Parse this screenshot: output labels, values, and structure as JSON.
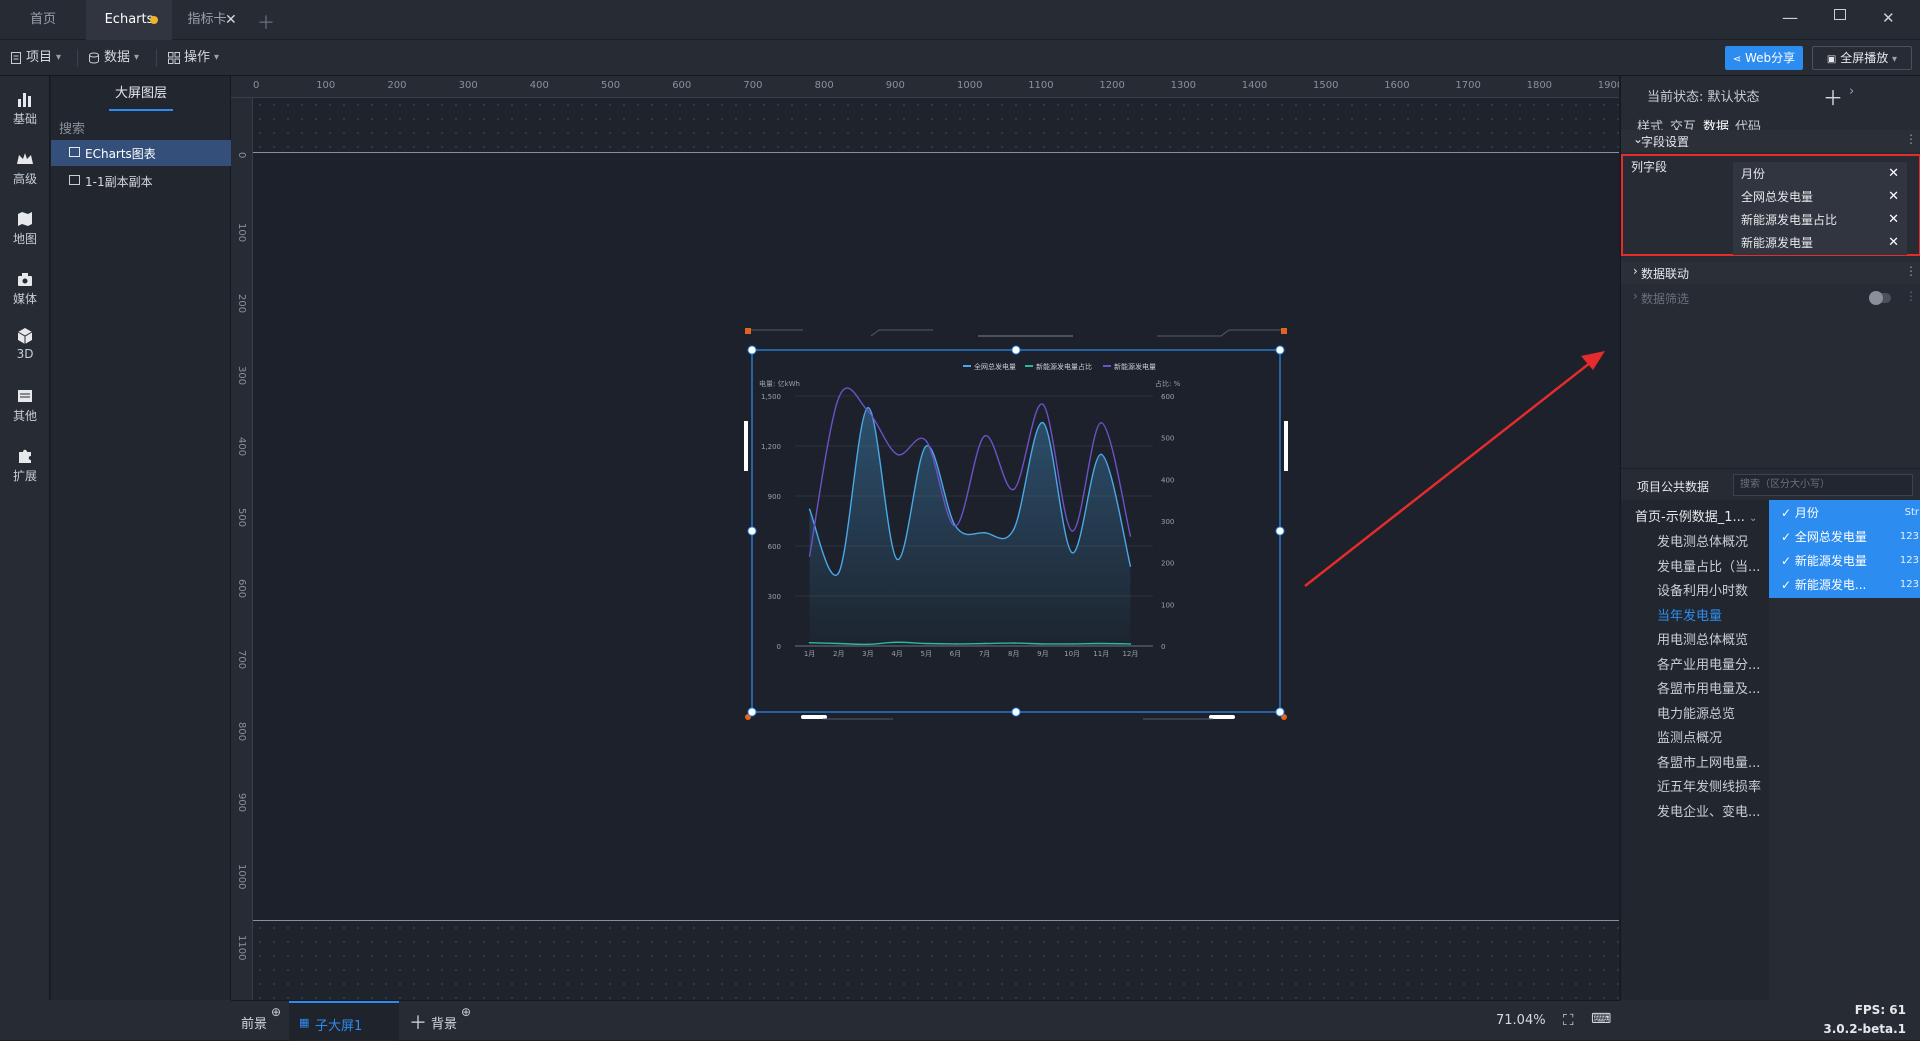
{
  "tabs": [
    {
      "label": "首页"
    },
    {
      "label": "Echarts"
    },
    {
      "label": "指标卡"
    }
  ],
  "toolbar": {
    "project": "项目",
    "data": "数据",
    "operation": "操作",
    "web_share": "Web分享",
    "fullscreen": "全屏播放"
  },
  "leftbar": [
    {
      "label": "基础"
    },
    {
      "label": "高级"
    },
    {
      "label": "地图"
    },
    {
      "label": "媒体"
    },
    {
      "label": "3D"
    },
    {
      "label": "其他"
    },
    {
      "label": "扩展"
    }
  ],
  "layers": {
    "title": "大屏图层",
    "search": "搜索",
    "items": [
      {
        "label": "ECharts图表"
      },
      {
        "label": "1-1副本副本"
      }
    ]
  },
  "ruler": {
    "top": [
      "0",
      "100",
      "200",
      "300",
      "400",
      "500",
      "600",
      "700",
      "800",
      "900",
      "1000",
      "1100",
      "1200",
      "1300",
      "1400",
      "1500",
      "1600",
      "1700",
      "1800",
      "1900"
    ],
    "left": [
      "0",
      "100",
      "200",
      "300",
      "400",
      "500",
      "600",
      "700",
      "800",
      "900",
      "1000",
      "1100"
    ]
  },
  "chart_data": {
    "type": "line",
    "legend": [
      "全网总发电量",
      "新能源发电量占比",
      "新能源发电量"
    ],
    "y_left_label": "电量: 亿kWh",
    "y_right_label": "占比: %",
    "categories": [
      "1月",
      "2月",
      "3月",
      "4月",
      "5月",
      "6月",
      "7月",
      "8月",
      "9月",
      "10月",
      "11月",
      "12月"
    ],
    "y_left_ticks": [
      "1,500",
      "1,200",
      "900",
      "600",
      "300",
      "0"
    ],
    "y_right_ticks": [
      "600",
      "500",
      "400",
      "300",
      "200",
      "100",
      "0"
    ],
    "ylim_left": [
      0,
      1500
    ],
    "ylim_right": [
      0,
      600
    ],
    "series": [
      {
        "name": "全网总发电量",
        "axis": "left",
        "color": "#4aa8e8",
        "values": [
          820,
          440,
          1430,
          520,
          1200,
          720,
          680,
          700,
          1340,
          560,
          1150,
          480
        ]
      },
      {
        "name": "新能源发电量占比",
        "axis": "right",
        "color": "#2bb7a2",
        "values": [
          8,
          6,
          4,
          9,
          6,
          5,
          6,
          7,
          5,
          5,
          6,
          5
        ]
      },
      {
        "name": "新能源发电量",
        "axis": "left",
        "color": "#6b52c8",
        "values": [
          540,
          1490,
          1410,
          1150,
          1230,
          720,
          1260,
          940,
          1450,
          690,
          1340,
          660
        ]
      }
    ]
  },
  "right": {
    "state_label": "当前状态:",
    "state_value": "默认状态",
    "tabs": [
      {
        "label": "样式"
      },
      {
        "label": "交互"
      },
      {
        "label": "数据"
      },
      {
        "label": "代码"
      }
    ],
    "field_settings": "字段设置",
    "column_fields_label": "列字段",
    "fields": [
      {
        "label": "月份"
      },
      {
        "label": "全网总发电量"
      },
      {
        "label": "新能源发电量占比"
      },
      {
        "label": "新能源发电量"
      }
    ],
    "data_link": "数据联动",
    "data_filter": "数据筛选",
    "public_data": "项目公共数据",
    "search_placeholder": "搜索（区分大小写）",
    "dataset_select": "首页-示例数据_1...",
    "datasets": [
      {
        "label": "发电测总体概况"
      },
      {
        "label": "发电量占比（当..."
      },
      {
        "label": "设备利用小时数"
      },
      {
        "label": "当年发电量"
      },
      {
        "label": "用电测总体概览"
      },
      {
        "label": "各产业用电量分..."
      },
      {
        "label": "各盟市用电量及..."
      },
      {
        "label": "电力能源总览"
      },
      {
        "label": "监测点概况"
      },
      {
        "label": "各盟市上网电量..."
      },
      {
        "label": "近五年发侧线损率"
      },
      {
        "label": "发电企业、变电..."
      }
    ],
    "selected_fields": [
      {
        "label": "月份",
        "type": "Str"
      },
      {
        "label": "全网总发电量",
        "type": "123"
      },
      {
        "label": "新能源发电量",
        "type": "123"
      },
      {
        "label": "新能源发电...",
        "type": "123"
      }
    ]
  },
  "bottom": {
    "foreground": "前景",
    "screen": "子大屏1",
    "background": "背景",
    "zoom": "71.04%",
    "fps": "FPS: 61",
    "version": "3.0.2-beta.1"
  },
  "colors": {
    "accent": "#2d8cf0",
    "highlight_red": "#e52b2b",
    "active_dataset": "#2d8cf0"
  }
}
